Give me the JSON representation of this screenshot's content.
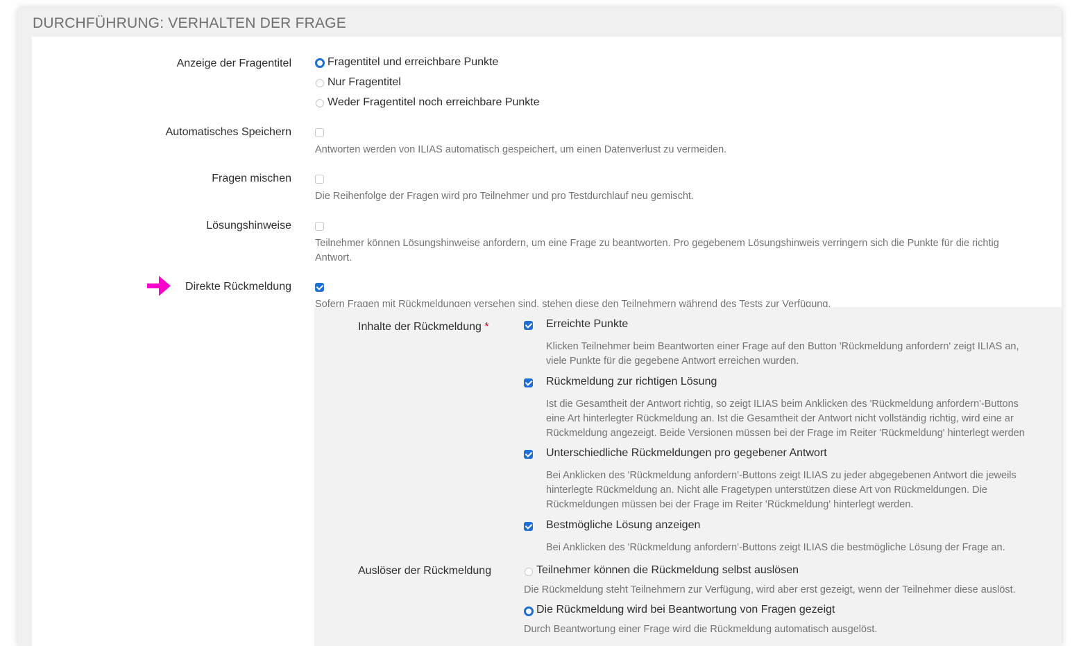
{
  "section": {
    "title": "DURCHFÜHRUNG: VERHALTEN DER FRAGE"
  },
  "fragentitel": {
    "label": "Anzeige der Fragentitel",
    "options": [
      {
        "label": "Fragentitel und erreichbare Punkte",
        "selected": true
      },
      {
        "label": "Nur Fragentitel",
        "selected": false
      },
      {
        "label": "Weder Fragentitel noch erreichbare Punkte",
        "selected": false
      }
    ]
  },
  "autosave": {
    "label": "Automatisches Speichern",
    "checked": false,
    "help": "Antworten werden von ILIAS automatisch gespeichert, um einen Datenverlust zu vermeiden."
  },
  "shuffle": {
    "label": "Fragen mischen",
    "checked": false,
    "help": "Die Reihenfolge der Fragen wird pro Teilnehmer und pro Testdurchlauf neu gemischt."
  },
  "hints": {
    "label": "Lösungshinweise",
    "checked": false,
    "help_line1": "Teilnehmer können Lösungshinweise anfordern, um eine Frage zu beantworten. Pro gegebenem Lösungshinweis verringern sich die Punkte für die richtig",
    "help_line2": "Antwort."
  },
  "feedback": {
    "label": "Direkte Rückmeldung",
    "checked": true,
    "help": "Sofern Fragen mit Rückmeldungen versehen sind, stehen diese den Teilnehmern während des Tests zur Verfügung.",
    "contents": {
      "label": "Inhalte der Rückmeldung",
      "required_mark": "*",
      "items": [
        {
          "label": "Erreichte Punkte",
          "checked": true,
          "help": [
            "Klicken Teilnehmer beim Beantworten einer Frage auf den Button 'Rückmeldung anfordern' zeigt ILIAS an,",
            "viele Punkte für die gegebene Antwort erreichen wurden."
          ]
        },
        {
          "label": "Rückmeldung zur richtigen Lösung",
          "checked": true,
          "help": [
            "Ist die Gesamtheit der Antwort richtig, so zeigt ILIAS beim Anklicken des 'Rückmeldung anfordern'-Buttons",
            "eine Art hinterlegter Rückmeldung an. Ist die Gesamtheit der Antwort nicht vollständig richtig, wird eine ar",
            "Rückmeldung angezeigt. Beide Versionen müssen bei der Frage im Reiter 'Rückmeldung' hinterlegt werden"
          ]
        },
        {
          "label": "Unterschiedliche Rückmeldungen pro gegebener Antwort",
          "checked": true,
          "help": [
            "Bei Anklicken des 'Rückmeldung anfordern'-Buttons zeigt ILIAS zu jeder abgegebenen Antwort die jeweils",
            "hinterlegte Rückmeldung an. Nicht alle Fragetypen unterstützen diese Art von Rückmeldungen. Die",
            "Rückmeldungen müssen bei der Frage im Reiter 'Rückmeldung' hinterlegt werden."
          ]
        },
        {
          "label": "Bestmögliche Lösung anzeigen",
          "checked": true,
          "help": [
            "Bei Anklicken des 'Rückmeldung anfordern'-Buttons zeigt ILIAS die bestmögliche Lösung der Frage an."
          ]
        }
      ]
    },
    "trigger": {
      "label": "Auslöser der Rückmeldung",
      "options": [
        {
          "label": "Teilnehmer können die Rückmeldung selbst auslösen",
          "selected": false,
          "help": "Die Rückmeldung steht Teilnehmern zur Verfügung, wird aber erst gezeigt, wenn der Teilnehmer diese auslöst."
        },
        {
          "label": "Die Rückmeldung wird bei Beantwortung von Fragen gezeigt",
          "selected": true,
          "help": "Durch Beantwortung einer Frage wird die Rückmeldung automatisch ausgelöst."
        }
      ]
    }
  },
  "colors": {
    "accent": "#1d6fd6",
    "arrow": "#ff00cc",
    "required": "#d0021b"
  },
  "icons": {
    "pointer": "right-arrow-icon"
  }
}
